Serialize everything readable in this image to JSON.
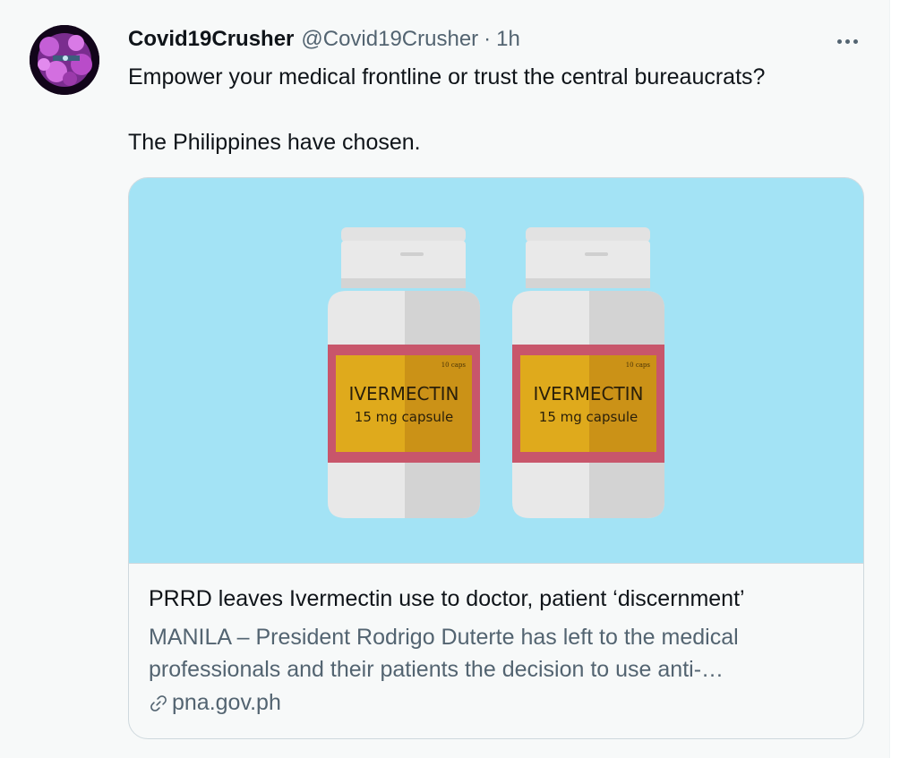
{
  "tweet": {
    "display_name": "Covid19Crusher",
    "handle": "@Covid19Crusher",
    "separator": "·",
    "time": "1h",
    "more_icon": "more-horizontal-icon",
    "text_lines": [
      "Empower your medical frontline or trust the central bureaucrats?",
      "The Philippines have chosen."
    ]
  },
  "card": {
    "image": {
      "bottles": [
        {
          "label_small": "10 caps",
          "label_title": "IVERMECTIN",
          "label_sub": "15 mg capsule"
        },
        {
          "label_small": "10 caps",
          "label_title": "IVERMECTIN",
          "label_sub": "15 mg capsule"
        }
      ]
    },
    "title": "PRRD leaves Ivermectin use to doctor, patient ‘discernment’",
    "description": "MANILA – President Rodrigo Duterte has left to the medical professionals and their patients the decision to use anti-…",
    "domain": "pna.gov.ph",
    "link_icon": "link-icon"
  },
  "colors": {
    "image_background": "#a3e3f5",
    "label_red": "#c8566b",
    "label_yellow": "#dfaa1c",
    "secondary_text": "#536471"
  }
}
